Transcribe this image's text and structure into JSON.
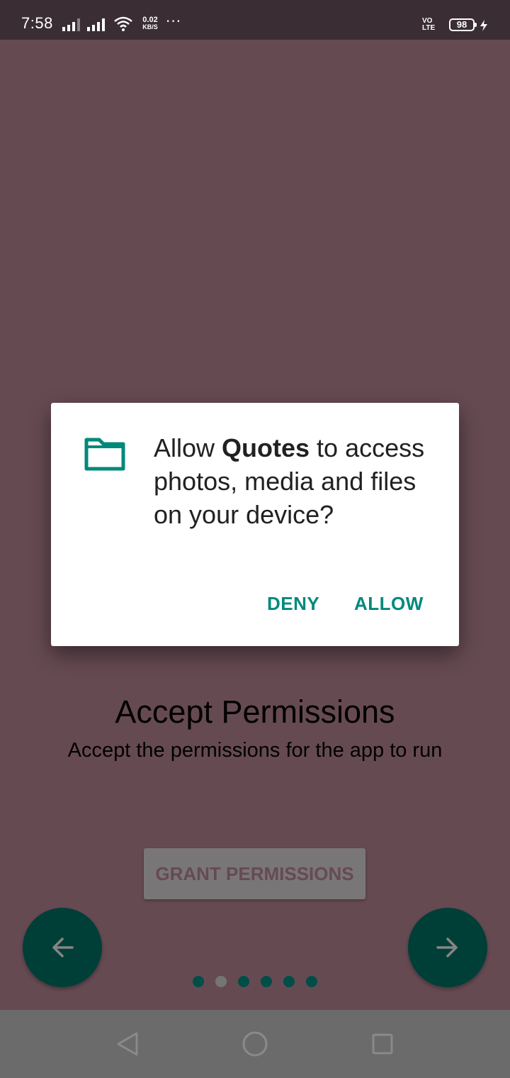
{
  "status_bar": {
    "time": "7:58",
    "net_speed_value": "0.02",
    "net_speed_unit": "KB/S",
    "more": "···",
    "volte_top": "VO",
    "volte_bottom": "LTE",
    "battery": "98"
  },
  "app": {
    "title": "Accept Permissions",
    "subtitle": "Accept the permissions for the app to run",
    "grant_button_label": "GRANT PERMISSIONS",
    "page_indicator": {
      "count": 6,
      "current": 2
    }
  },
  "dialog": {
    "icon": "folder-icon",
    "message_prefix": "Allow ",
    "app_name": "Quotes",
    "message_suffix": " to access photos, media and files on your device?",
    "deny_label": "DENY",
    "allow_label": "ALLOW"
  },
  "colors": {
    "background": "#C48E9E",
    "accent": "#00897B",
    "fab": "#00796B",
    "status_bar": "#3A2D33"
  },
  "icons": {
    "fab_prev": "arrow-left-icon",
    "fab_next": "arrow-right-icon",
    "nav_back": "back-triangle-icon",
    "nav_home": "home-circle-icon",
    "nav_recents": "recents-square-icon"
  }
}
